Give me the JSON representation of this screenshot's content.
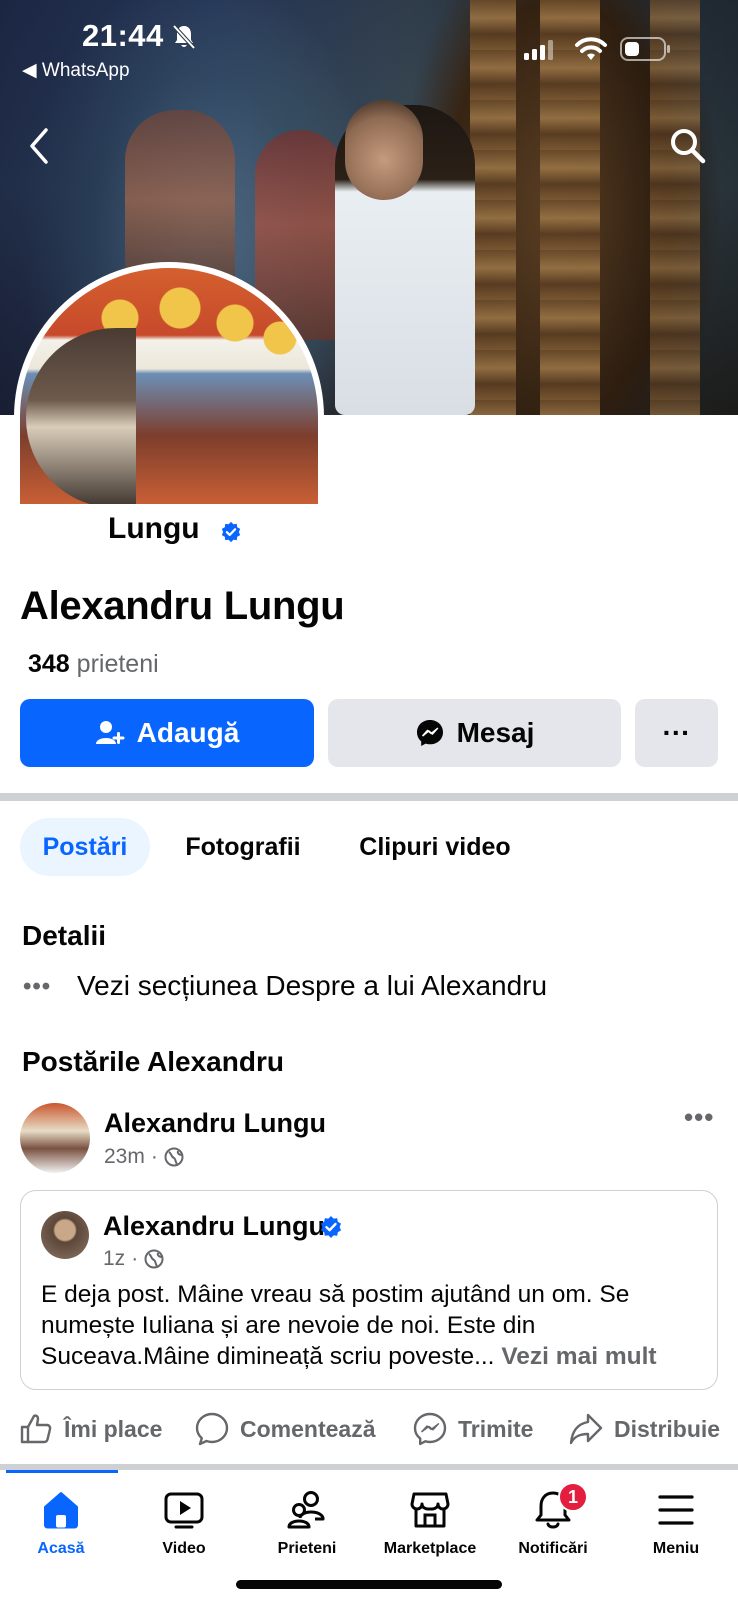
{
  "status_bar": {
    "time": "21:44",
    "back_app": "◀ WhatsApp"
  },
  "cover": {
    "back_icon": "chevron-left-icon",
    "search_icon": "search-icon"
  },
  "profile": {
    "partial_name": "Lungu",
    "name": "Alexandru Lungu",
    "friends_count": "348",
    "friends_label": "prieteni",
    "verified": true
  },
  "actions": {
    "add_label": "Adaugă",
    "message_label": "Mesaj",
    "more_label": "···"
  },
  "tabs": [
    {
      "label": "Postări",
      "active": true
    },
    {
      "label": "Fotografii",
      "active": false
    },
    {
      "label": "Clipuri video",
      "active": false
    }
  ],
  "details": {
    "title": "Detalii",
    "dots": "•••",
    "about_link": "Vezi secțiunea Despre a lui Alexandru"
  },
  "posts_section": {
    "title": "Postările Alexandru"
  },
  "post": {
    "author": "Alexandru Lungu",
    "time": "23m",
    "separator": "·",
    "more": "•••",
    "shared": {
      "author": "Alexandru Lungu",
      "time": "1z",
      "separator": "·",
      "text": "E deja post. Mâine vreau să postim ajutând un om. Se numește Iuliana și are nevoie de noi. Este din Suceava.Mâine dimineață scriu poveste...",
      "see_more": "Vezi mai mult"
    }
  },
  "reactions": {
    "like": "Îmi place",
    "comment": "Comentează",
    "send": "Trimite",
    "share": "Distribuie"
  },
  "bottom_nav": [
    {
      "label": "Acasă",
      "icon": "home-icon",
      "active": true
    },
    {
      "label": "Video",
      "icon": "video-icon",
      "active": false
    },
    {
      "label": "Prieteni",
      "icon": "friends-icon",
      "active": false
    },
    {
      "label": "Marketplace",
      "icon": "marketplace-icon",
      "active": false
    },
    {
      "label": "Notificări",
      "icon": "bell-icon",
      "active": false,
      "badge": "1"
    },
    {
      "label": "Meniu",
      "icon": "menu-icon",
      "active": false
    }
  ],
  "colors": {
    "accent": "#0866ff",
    "secondary_button": "#e4e6eb",
    "muted_text": "#65676b",
    "badge": "#e41e3f"
  }
}
